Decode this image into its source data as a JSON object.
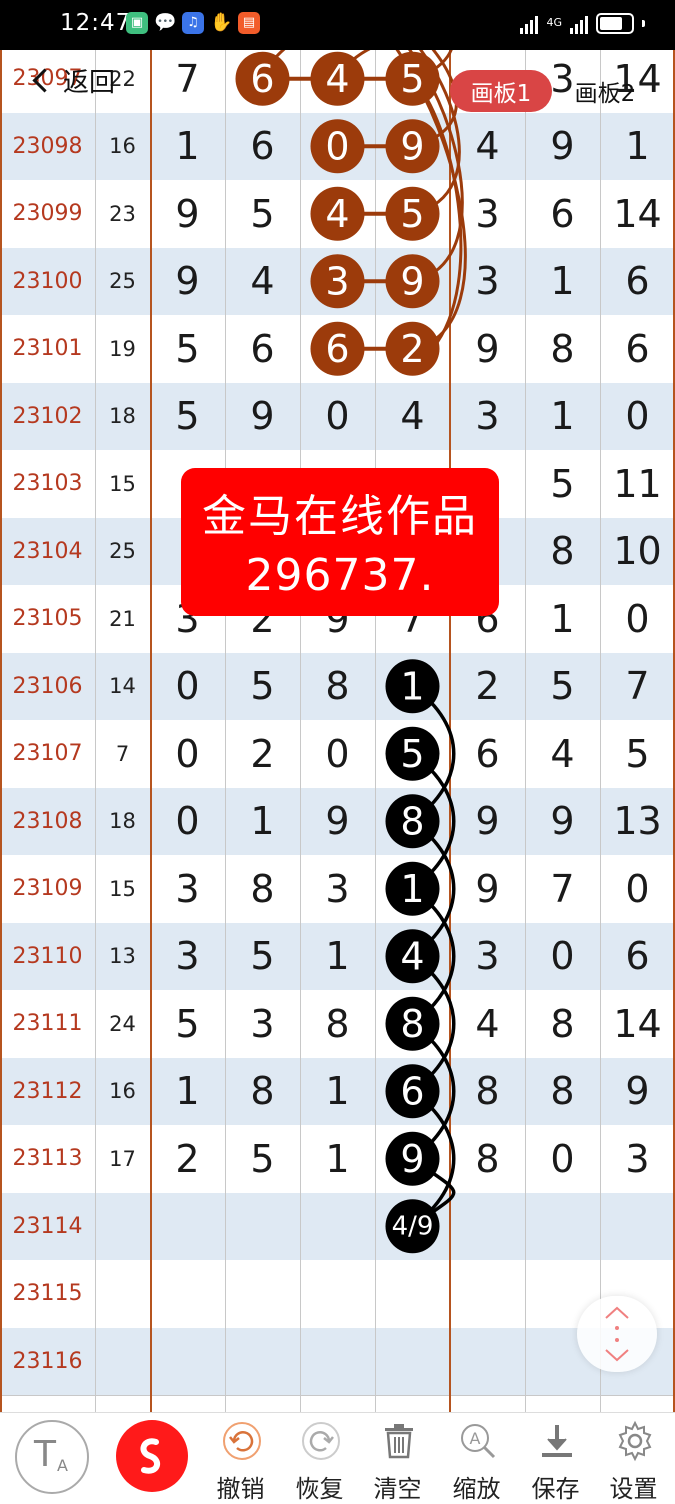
{
  "status": {
    "time": "12:47",
    "network": "4G"
  },
  "nav": {
    "back_label": "返回",
    "tab1": "画板1",
    "tab2": "画板2"
  },
  "rows": [
    {
      "period": "23097",
      "sum": "22",
      "d": [
        "7",
        "6",
        "4",
        "5",
        "",
        "3",
        "14"
      ]
    },
    {
      "period": "23098",
      "sum": "16",
      "d": [
        "1",
        "6",
        "0",
        "9",
        "4",
        "9",
        "1"
      ]
    },
    {
      "period": "23099",
      "sum": "23",
      "d": [
        "9",
        "5",
        "4",
        "5",
        "3",
        "6",
        "14"
      ]
    },
    {
      "period": "23100",
      "sum": "25",
      "d": [
        "9",
        "4",
        "3",
        "9",
        "3",
        "1",
        "6"
      ]
    },
    {
      "period": "23101",
      "sum": "19",
      "d": [
        "5",
        "6",
        "6",
        "2",
        "9",
        "8",
        "6"
      ]
    },
    {
      "period": "23102",
      "sum": "18",
      "d": [
        "5",
        "9",
        "0",
        "4",
        "3",
        "1",
        "0"
      ]
    },
    {
      "period": "23103",
      "sum": "15",
      "d": [
        "",
        "",
        "",
        "",
        "",
        "5",
        "11"
      ]
    },
    {
      "period": "23104",
      "sum": "25",
      "d": [
        "",
        "",
        "",
        "",
        "",
        "8",
        "10"
      ]
    },
    {
      "period": "23105",
      "sum": "21",
      "d": [
        "3",
        "2",
        "9",
        "7",
        "6",
        "1",
        "0"
      ]
    },
    {
      "period": "23106",
      "sum": "14",
      "d": [
        "0",
        "5",
        "8",
        "1",
        "2",
        "5",
        "7"
      ]
    },
    {
      "period": "23107",
      "sum": "7",
      "d": [
        "0",
        "2",
        "0",
        "5",
        "6",
        "4",
        "5"
      ]
    },
    {
      "period": "23108",
      "sum": "18",
      "d": [
        "0",
        "1",
        "9",
        "8",
        "9",
        "9",
        "13"
      ]
    },
    {
      "period": "23109",
      "sum": "15",
      "d": [
        "3",
        "8",
        "3",
        "1",
        "9",
        "7",
        "0"
      ]
    },
    {
      "period": "23110",
      "sum": "13",
      "d": [
        "3",
        "5",
        "1",
        "4",
        "3",
        "0",
        "6"
      ]
    },
    {
      "period": "23111",
      "sum": "24",
      "d": [
        "5",
        "3",
        "8",
        "8",
        "4",
        "8",
        "14"
      ]
    },
    {
      "period": "23112",
      "sum": "16",
      "d": [
        "1",
        "8",
        "1",
        "6",
        "8",
        "8",
        "9"
      ]
    },
    {
      "period": "23113",
      "sum": "17",
      "d": [
        "2",
        "5",
        "1",
        "9",
        "8",
        "0",
        "3"
      ]
    },
    {
      "period": "23114",
      "sum": "",
      "d": [
        "",
        "",
        "",
        "",
        "",
        "",
        ""
      ]
    },
    {
      "period": "23115",
      "sum": "",
      "d": [
        "",
        "",
        "",
        "",
        "",
        "",
        ""
      ]
    },
    {
      "period": "23116",
      "sum": "",
      "d": [
        "",
        "",
        "",
        "",
        "",
        "",
        ""
      ]
    }
  ],
  "brown_balls": [
    {
      "row": 0,
      "col": 1,
      "v": "6"
    },
    {
      "row": 0,
      "col": 2,
      "v": "4"
    },
    {
      "row": 0,
      "col": 3,
      "v": "5"
    },
    {
      "row": 1,
      "col": 2,
      "v": "0"
    },
    {
      "row": 1,
      "col": 3,
      "v": "9"
    },
    {
      "row": 2,
      "col": 2,
      "v": "4"
    },
    {
      "row": 2,
      "col": 3,
      "v": "5"
    },
    {
      "row": 3,
      "col": 2,
      "v": "3"
    },
    {
      "row": 3,
      "col": 3,
      "v": "9"
    },
    {
      "row": 4,
      "col": 2,
      "v": "6"
    },
    {
      "row": 4,
      "col": 3,
      "v": "2"
    }
  ],
  "black_balls": [
    {
      "row": 9,
      "v": "1"
    },
    {
      "row": 10,
      "v": "5"
    },
    {
      "row": 11,
      "v": "8"
    },
    {
      "row": 12,
      "v": "1"
    },
    {
      "row": 13,
      "v": "4"
    },
    {
      "row": 14,
      "v": "8"
    },
    {
      "row": 15,
      "v": "6"
    },
    {
      "row": 16,
      "v": "9"
    },
    {
      "row": 17,
      "v": "4/9"
    }
  ],
  "watermark": {
    "line1": "金马在线作品",
    "line2": "296737."
  },
  "toolbar": {
    "undo": "撤销",
    "redo": "恢复",
    "clear": "清空",
    "zoom": "缩放",
    "save": "保存",
    "settings": "设置"
  },
  "colors": {
    "brown": "#9c3b0b",
    "period_text": "#b5391f",
    "active_tab": "#d94545",
    "draw_button": "#ff1a1a"
  }
}
